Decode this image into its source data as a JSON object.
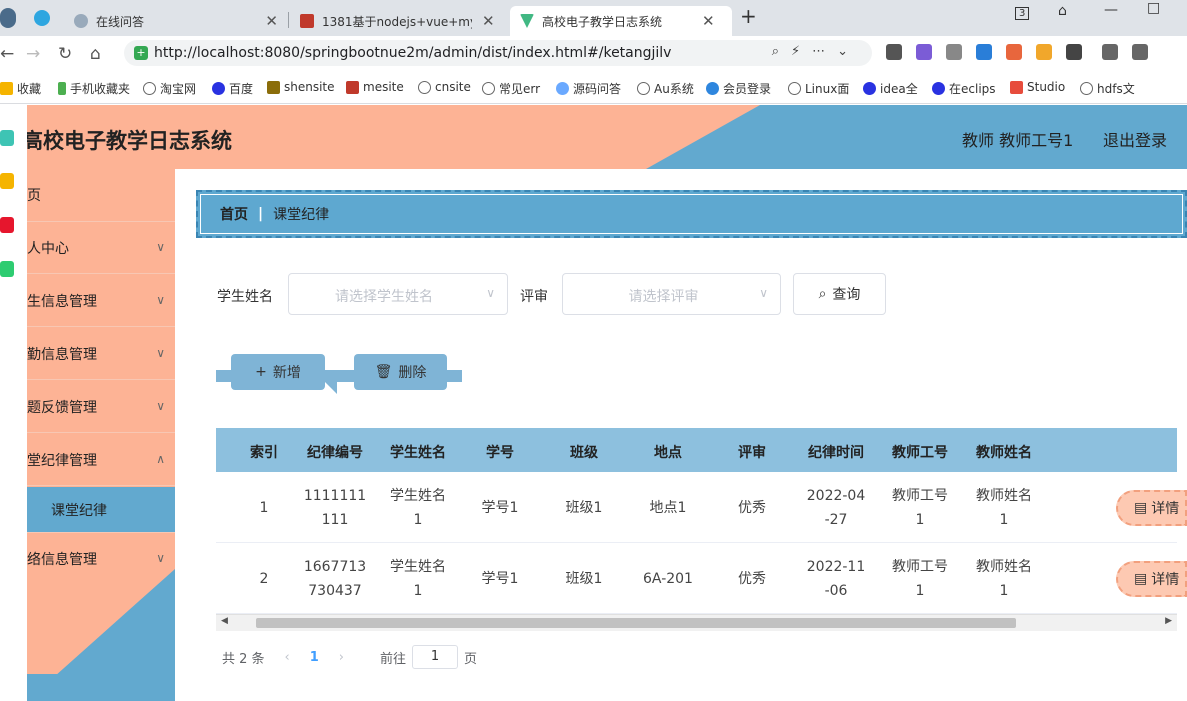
{
  "browser": {
    "tabs": [
      {
        "title": "在线问答",
        "close": "✕"
      },
      {
        "title": "1381基于nodejs+vue+mysq",
        "close": "✕"
      },
      {
        "title": "高校电子教学日志系统",
        "close": "✕"
      }
    ],
    "new_tab": "+",
    "badge_count": "3",
    "url": "http://localhost:8080/springbootnue2m/admin/dist/index.html#/ketangjilv",
    "bookmarks": [
      "收藏",
      "手机收藏夹",
      "淘宝网",
      "百度",
      "shensite",
      "mesite",
      "cnsite",
      "常见err",
      "源码问答",
      "Au系统",
      "会员登录",
      "Linux面",
      "idea全",
      "在eclips",
      "Studio",
      "hdfs文"
    ]
  },
  "app": {
    "title": "高校电子教学日志系统",
    "user": "教师 教师工号1",
    "logout": "退出登录"
  },
  "sidebar": {
    "items": [
      {
        "label": "页"
      },
      {
        "label": "人中心"
      },
      {
        "label": "生信息管理"
      },
      {
        "label": "勤信息管理"
      },
      {
        "label": "题反馈管理"
      },
      {
        "label": "堂纪律管理"
      },
      {
        "label": "课堂纪律"
      },
      {
        "label": "络信息管理"
      }
    ]
  },
  "breadcrumb": {
    "home": "首页",
    "separator": "|",
    "current": "课堂纪律"
  },
  "search": {
    "student_label": "学生姓名",
    "student_placeholder": "请选择学生姓名",
    "review_label": "评审",
    "review_placeholder": "请选择评审",
    "query": "查询"
  },
  "actions": {
    "add": "新增",
    "delete": "删除"
  },
  "table": {
    "headers": [
      "索引",
      "纪律编号",
      "学生姓名",
      "学号",
      "班级",
      "地点",
      "评审",
      "纪律时间",
      "教师工号",
      "教师姓名"
    ],
    "rows": [
      {
        "index": "1",
        "code_a": "1111111",
        "code_b": "111",
        "name_a": "学生姓名",
        "name_b": "1",
        "student_no": "学号1",
        "class": "班级1",
        "place": "地点1",
        "review": "优秀",
        "time_a": "2022-04",
        "time_b": "-27",
        "tno_a": "教师工号",
        "tno_b": "1",
        "tname_a": "教师姓名",
        "tname_b": "1",
        "detail": "详情"
      },
      {
        "index": "2",
        "code_a": "1667713",
        "code_b": "730437",
        "name_a": "学生姓名",
        "name_b": "1",
        "student_no": "学号1",
        "class": "班级1",
        "place": "6A-201",
        "review": "优秀",
        "time_a": "2022-11",
        "time_b": "-06",
        "tno_a": "教师工号",
        "tno_b": "1",
        "tname_a": "教师姓名",
        "tname_b": "1",
        "detail": "详情"
      }
    ]
  },
  "pagination": {
    "total": "共 2 条",
    "prev": "‹",
    "current": "1",
    "next": "›",
    "goto": "前往",
    "page_value": "1",
    "page_unit": "页"
  },
  "colors": {
    "peach": "#fdb395",
    "blue": "#62a9cf",
    "header_blue": "#8dc0de"
  }
}
